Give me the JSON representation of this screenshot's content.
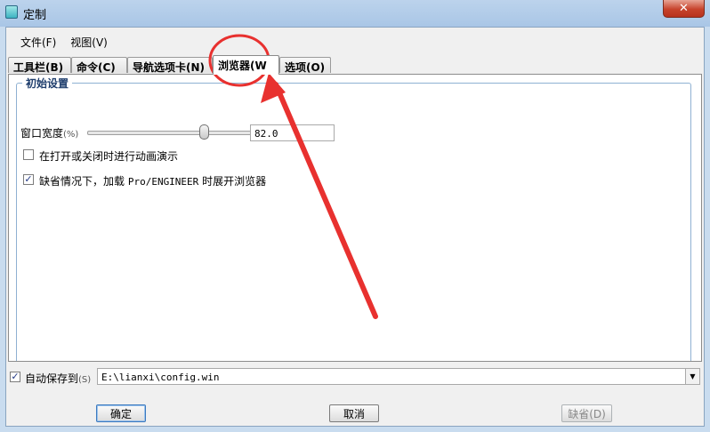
{
  "window": {
    "title": "定制",
    "close_glyph": "✕"
  },
  "menu": {
    "file": "文件(F)",
    "view": "视图(V)"
  },
  "tabs": [
    {
      "label": "工具栏(B)"
    },
    {
      "label": "命令(C)"
    },
    {
      "label": "导航选项卡(N)"
    },
    {
      "label": "浏览器(W"
    },
    {
      "label": "选项(O)"
    }
  ],
  "active_tab_index": 3,
  "group": {
    "title": "初始设置",
    "width_label": "窗口宽度",
    "width_unit": "(%)",
    "width_value": "82.0",
    "slider_fraction": 0.72,
    "animate_label": "在打开或关闭时进行动画演示",
    "animate_checked": false,
    "expand_label_prefix": "缺省情况下，加载 ",
    "expand_label_product": "Pro/ENGINEER",
    "expand_label_suffix": " 时展开浏览器",
    "expand_checked": true
  },
  "autosave": {
    "label": "自动保存到",
    "shortcut": "(S)",
    "checked": true,
    "path": "E:\\lianxi\\config.win"
  },
  "buttons": {
    "ok": "确定",
    "cancel": "取消",
    "default": "缺省(D)"
  },
  "icons": {
    "check": "✓",
    "dropdown": "▼"
  },
  "colors": {
    "annotation": "#e8312f",
    "accent": "#3b79bf"
  }
}
